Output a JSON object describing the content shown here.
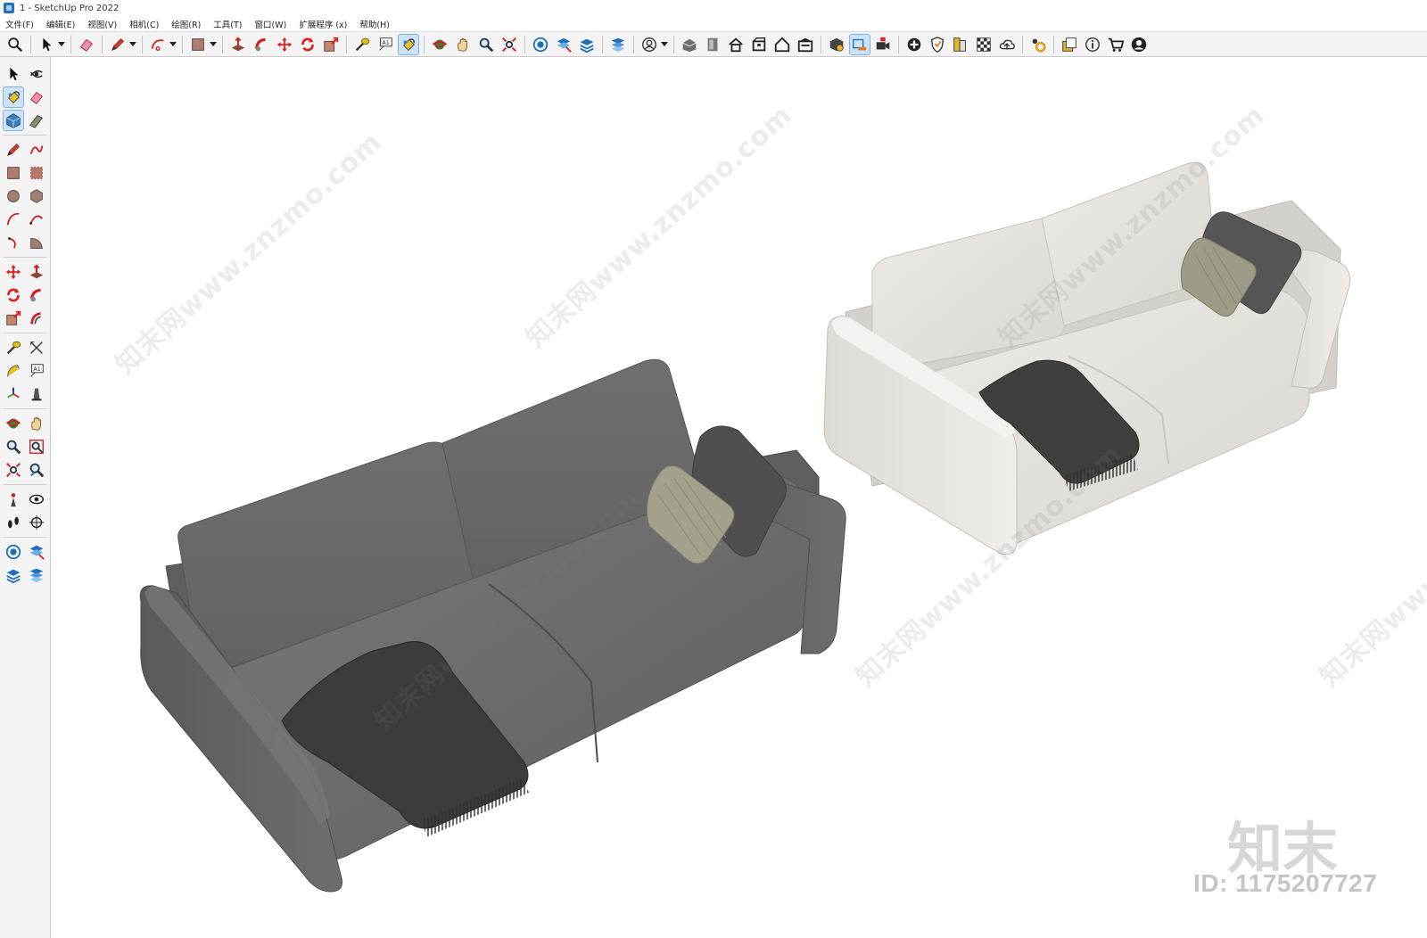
{
  "window": {
    "title": "1 - SketchUp Pro 2022"
  },
  "menu": [
    "文件(F)",
    "编辑(E)",
    "视图(V)",
    "相机(C)",
    "绘图(R)",
    "工具(T)",
    "窗口(W)",
    "扩展程序 (x)",
    "帮助(H)"
  ],
  "toolbar": {
    "groups": [
      [
        "zoom-icon"
      ],
      [
        "select-icon",
        "dropdown"
      ],
      [
        "eraser-icon"
      ],
      [
        "pencil-icon",
        "dropdown"
      ],
      [
        "arc-icon",
        "dropdown"
      ],
      [
        "rectangle-icon",
        "dropdown"
      ],
      [
        "push-pull-icon",
        "follow-me-icon",
        "move-icon",
        "rotate-icon",
        "scale-icon"
      ],
      [
        "tape-measure-icon",
        "text-icon",
        "paint-bucket-icon"
      ],
      [
        "orbit-icon",
        "pan-icon",
        "zoom-tool-icon",
        "zoom-extents-icon"
      ],
      [
        "sandbox-icon",
        "section-plane-icon",
        "layers-icon"
      ],
      [
        "solid-tools-icon"
      ],
      [
        "account-icon",
        "dropdown"
      ],
      [
        "3d-warehouse-icon",
        "components-icon",
        "house-icon",
        "box-icon",
        "home-icon",
        "garage-icon"
      ],
      [
        "styles-icon",
        "scenes-icon",
        "video-icon"
      ],
      [
        "add-icon",
        "shield-icon",
        "materials-icon",
        "checker-icon",
        "cloud-icon"
      ],
      [
        "extension-manager-icon"
      ],
      [
        "window-icon",
        "info-icon",
        "cart-icon",
        "user-icon"
      ]
    ],
    "active": [
      "paint-bucket-icon",
      "scenes-icon"
    ]
  },
  "left_tools": {
    "rows": [
      [
        "select-tool",
        "orbit-tool"
      ],
      [
        "paint-bucket-tool",
        "eraser-tool"
      ],
      [
        "component-tool",
        "tag-tool"
      ],
      "sep",
      [
        "line-tool",
        "freehand-tool"
      ],
      [
        "rectangle-tool",
        "rotated-rect-tool"
      ],
      [
        "circle-tool",
        "polygon-tool"
      ],
      [
        "arc-tool",
        "two-point-arc-tool"
      ],
      [
        "three-point-arc-tool",
        "pie-tool"
      ],
      "sep",
      [
        "move-tool",
        "push-pull-tool"
      ],
      [
        "rotate-tool",
        "follow-me-tool"
      ],
      [
        "scale-tool",
        "offset-tool"
      ],
      "sep",
      [
        "tape-measure-tool",
        "dimension-tool"
      ],
      [
        "protractor-tool",
        "text-tool"
      ],
      [
        "axes-tool",
        "3d-text-tool"
      ],
      "sep",
      [
        "orbit-nav-tool",
        "pan-tool"
      ],
      [
        "zoom-nav-tool",
        "zoom-window-tool"
      ],
      [
        "zoom-extents-tool",
        "previous-view-tool"
      ],
      "sep",
      [
        "position-camera-tool",
        "look-around-tool"
      ],
      [
        "walk-tool",
        "section-plane-tool"
      ],
      "sep",
      [
        "sandbox-tool",
        "smoove-tool"
      ],
      [
        "stamp-tool",
        "drape-tool"
      ]
    ],
    "active": [
      "paint-bucket-tool",
      "component-tool"
    ]
  },
  "scene": {
    "watermark_text": "知末网www.znzmo.com",
    "logo_text": "知末",
    "id_text": "ID: 1175207727",
    "dark_sofa_color": "#6b6b6b",
    "light_sofa_color": "#e6e3df",
    "throw_color": "#3a3a3a",
    "pillow_dark": "#4d4d4d",
    "pillow_light": "#a8a58f"
  }
}
